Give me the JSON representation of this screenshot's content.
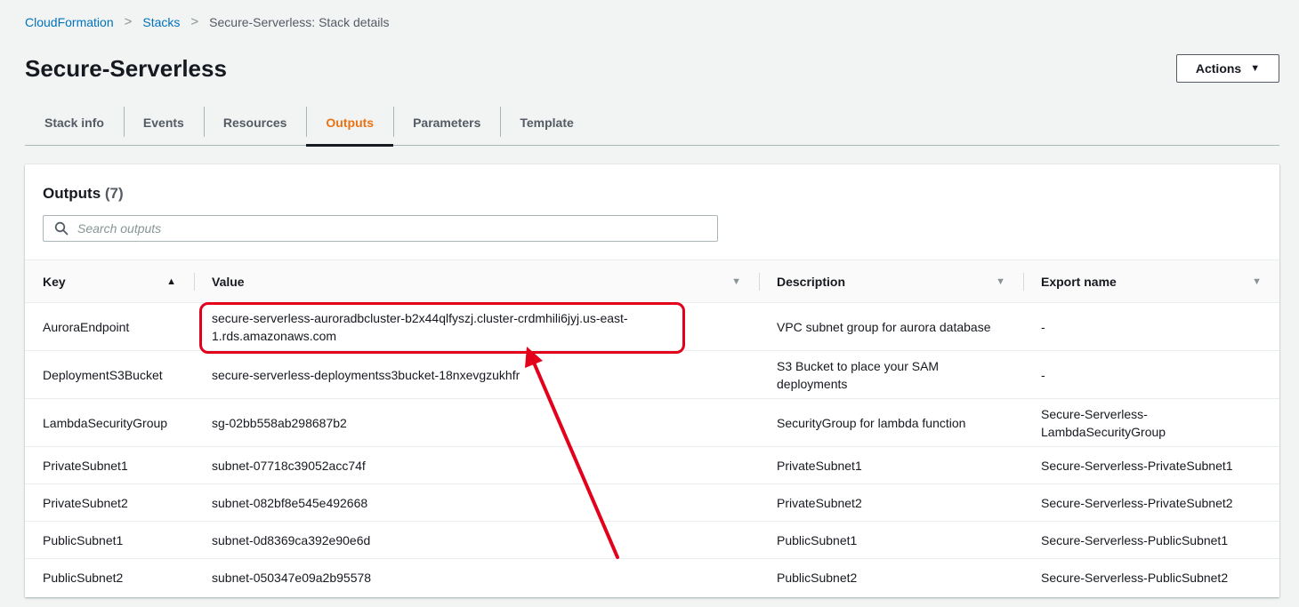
{
  "breadcrumb": {
    "items": [
      "CloudFormation",
      "Stacks"
    ],
    "current": "Secure-Serverless: Stack details"
  },
  "page_title": "Secure-Serverless",
  "actions_label": "Actions",
  "tabs": [
    {
      "label": "Stack info",
      "active": false
    },
    {
      "label": "Events",
      "active": false
    },
    {
      "label": "Resources",
      "active": false
    },
    {
      "label": "Outputs",
      "active": true
    },
    {
      "label": "Parameters",
      "active": false
    },
    {
      "label": "Template",
      "active": false
    }
  ],
  "outputs": {
    "title": "Outputs",
    "count": "(7)",
    "search_placeholder": "Search outputs",
    "columns": [
      "Key",
      "Value",
      "Description",
      "Export name"
    ],
    "rows": [
      {
        "key": "AuroraEndpoint",
        "value": "secure-serverless-auroradbcluster-b2x44qlfyszj.cluster-crdmhili6jyj.us-east-1.rds.amazonaws.com",
        "description": "VPC subnet group for aurora database",
        "export": "-"
      },
      {
        "key": "DeploymentS3Bucket",
        "value": "secure-serverless-deploymentss3bucket-18nxevgzukhfr",
        "description": "S3 Bucket to place your SAM deployments",
        "export": "-"
      },
      {
        "key": "LambdaSecurityGroup",
        "value": "sg-02bb558ab298687b2",
        "description": "SecurityGroup for lambda function",
        "export": "Secure-Serverless-LambdaSecurityGroup"
      },
      {
        "key": "PrivateSubnet1",
        "value": "subnet-07718c39052acc74f",
        "description": "PrivateSubnet1",
        "export": "Secure-Serverless-PrivateSubnet1"
      },
      {
        "key": "PrivateSubnet2",
        "value": "subnet-082bf8e545e492668",
        "description": "PrivateSubnet2",
        "export": "Secure-Serverless-PrivateSubnet2"
      },
      {
        "key": "PublicSubnet1",
        "value": "subnet-0d8369ca392e90e6d",
        "description": "PublicSubnet1",
        "export": "Secure-Serverless-PublicSubnet1"
      },
      {
        "key": "PublicSubnet2",
        "value": "subnet-050347e09a2b95578",
        "description": "PublicSubnet2",
        "export": "Secure-Serverless-PublicSubnet2"
      }
    ]
  },
  "colors": {
    "link": "#0073bb",
    "active_tab": "#ec7211",
    "annotation": "#e3001b"
  },
  "icons": {
    "search": "search-icon",
    "sort_asc": "sort-ascending-icon",
    "sort_desc": "sort-descending-icon",
    "caret": "caret-down-icon"
  }
}
